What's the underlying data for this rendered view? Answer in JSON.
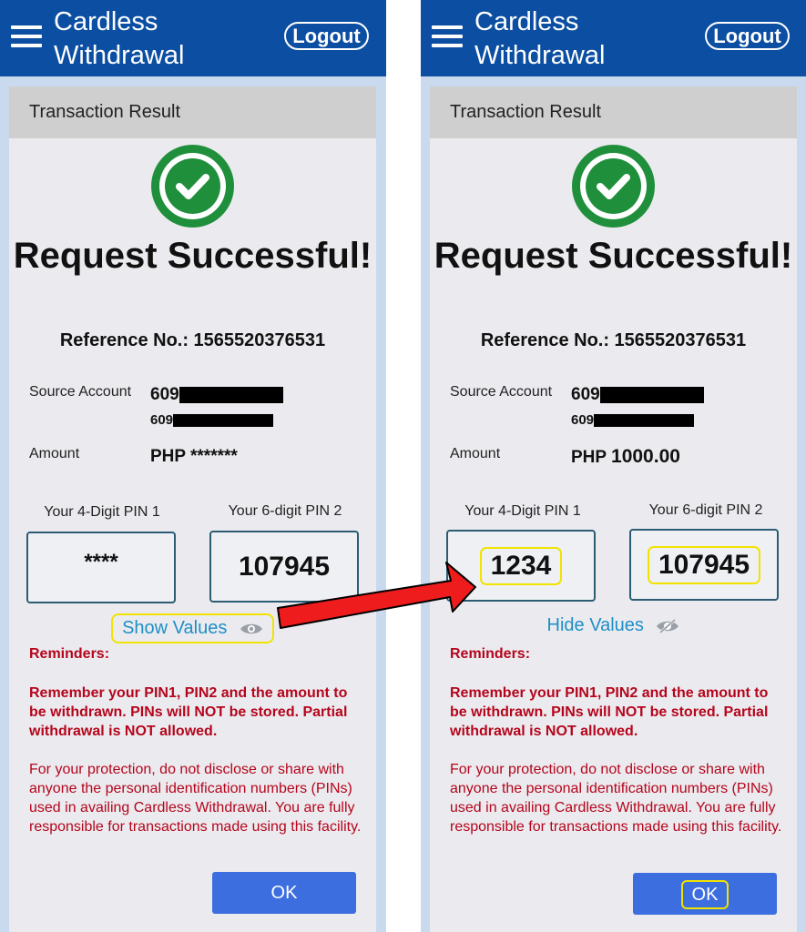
{
  "screens": [
    {
      "header": {
        "title": "Cardless Withdrawal",
        "logout_label": "Logout"
      },
      "card": {
        "title": "Transaction Result",
        "headline": "Request Successful!",
        "reference": "Reference No.: 1565520376531",
        "source_account_label": "Source Account",
        "source_account_prefix": "609",
        "source_account_prefix_2": "609",
        "amount_label": "Amount",
        "amount_currency": "PHP",
        "amount_value": "*******",
        "pin1_label": "Your 4-Digit PIN 1",
        "pin1_value": "****",
        "pin2_label": "Your 6-digit PIN 2",
        "pin2_value": "107945",
        "toggle_label": "Show Values",
        "reminders_title": "Reminders:",
        "reminder_bold": "Remember your PIN1, PIN2 and the amount to be withdrawn. PINs will NOT be stored. Partial withdrawal is NOT allowed.",
        "reminder_text": "For your protection, do not disclose or share with anyone the personal identification numbers (PINs) used in availing Cardless Withdrawal. You are fully responsible for transactions made using this facility.",
        "ok_label": "OK"
      }
    },
    {
      "header": {
        "title": "Cardless Withdrawal",
        "logout_label": "Logout"
      },
      "card": {
        "title": "Transaction Result",
        "headline": "Request Successful!",
        "reference": "Reference No.: 1565520376531",
        "source_account_label": "Source Account",
        "source_account_prefix": "609",
        "source_account_prefix_2": "609",
        "amount_label": "Amount",
        "amount_currency": "PHP",
        "amount_value": "1000.00",
        "pin1_label": "Your 4-Digit PIN 1",
        "pin1_value": "1234",
        "pin2_label": "Your 6-digit PIN 2",
        "pin2_value": "107945",
        "toggle_label": "Hide Values",
        "reminders_title": "Reminders:",
        "reminder_bold": "Remember your PIN1, PIN2 and the amount to be withdrawn. PINs will NOT be stored. Partial withdrawal is NOT allowed.",
        "reminder_text": "For your protection, do not disclose or share with anyone the personal identification numbers (PINs) used in availing Cardless Withdrawal. You are fully responsible for transactions made using this facility.",
        "ok_label": "OK"
      }
    }
  ],
  "icons": {
    "menu": "hamburger-icon",
    "success": "checkmark-circle-icon",
    "show": "eye-icon",
    "hide": "eye-slash-icon",
    "annotation": "red-arrow"
  },
  "colors": {
    "header_bg": "#0b4ea2",
    "card_bg": "#ebebef",
    "card_header_bg": "#cfcfcf",
    "success_green": "#1f8f3c",
    "link_blue": "#1e8fc6",
    "reminder_red": "#b5051c",
    "ok_button": "#3d6ee0",
    "highlight_yellow": "#f2e200",
    "arrow_red": "#ee1c1c"
  }
}
